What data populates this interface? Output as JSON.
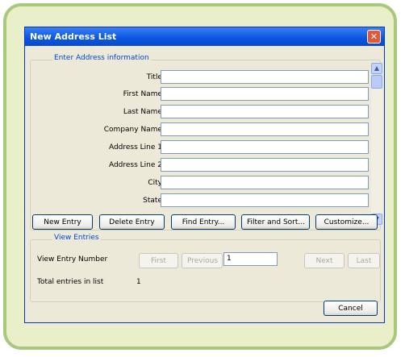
{
  "dialog": {
    "title": "New Address List",
    "close_symbol": "✕"
  },
  "address_group": {
    "legend": "Enter Address information",
    "fields": [
      {
        "label": "Title",
        "value": ""
      },
      {
        "label": "First Name",
        "value": ""
      },
      {
        "label": "Last Name",
        "value": ""
      },
      {
        "label": "Company Name",
        "value": ""
      },
      {
        "label": "Address Line 1",
        "value": ""
      },
      {
        "label": "Address Line 2",
        "value": ""
      },
      {
        "label": "City",
        "value": ""
      },
      {
        "label": "State",
        "value": ""
      }
    ]
  },
  "scrollbar": {
    "up": "▲",
    "down": "▼"
  },
  "actions": {
    "new_entry": "New Entry",
    "delete_entry": "Delete Entry",
    "find_entry": "Find Entry...",
    "filter_sort": "Filter and Sort...",
    "customize": "Customize..."
  },
  "view_group": {
    "legend": "View Entries",
    "entry_number_label": "View Entry Number",
    "first": "First",
    "previous": "Previous",
    "entry_number_value": "1",
    "next": "Next",
    "last": "Last",
    "total_label": "Total entries in list",
    "total_value": "1"
  },
  "cancel": "Cancel",
  "colors": {
    "frame_border": "#a9c77d",
    "frame_fill": "#e9efc9",
    "titlebar": "#0a55e0",
    "legend": "#0046d5"
  }
}
